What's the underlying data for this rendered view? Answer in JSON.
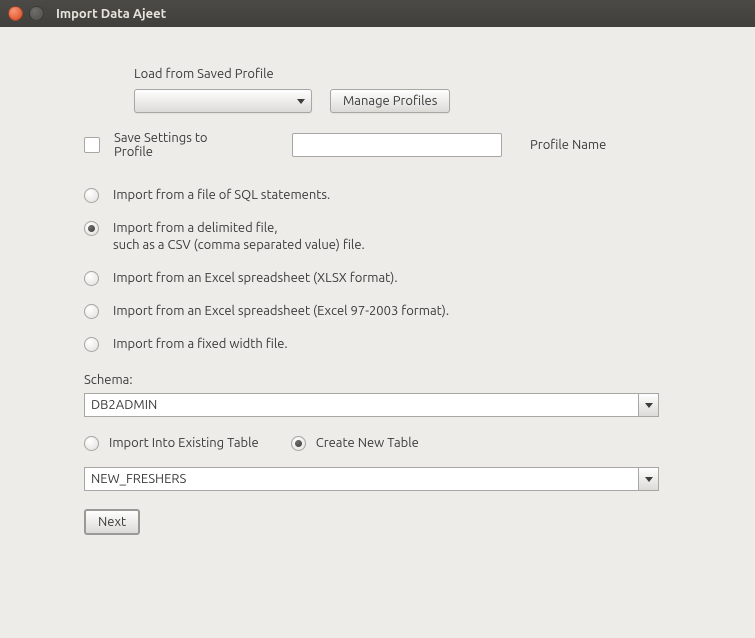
{
  "window": {
    "title": "Import Data Ajeet"
  },
  "profile": {
    "load_label": "Load from Saved Profile",
    "manage_button": "Manage Profiles",
    "save_label": "Save Settings to Profile",
    "profile_name_label": "Profile Name",
    "selected_profile": "",
    "profile_name_value": ""
  },
  "import_options": [
    {
      "label": "Import from a file of SQL statements.",
      "selected": false
    },
    {
      "label": "Import from a delimited file,\nsuch as a CSV (comma separated value) file.",
      "selected": true
    },
    {
      "label": "Import from an Excel spreadsheet (XLSX format).",
      "selected": false
    },
    {
      "label": "Import from an Excel spreadsheet (Excel 97-2003 format).",
      "selected": false
    },
    {
      "label": "Import from a fixed width file.",
      "selected": false
    }
  ],
  "schema": {
    "label": "Schema:",
    "value": "DB2ADMIN"
  },
  "destination": {
    "existing_label": "Import Into Existing Table",
    "create_label": "Create New Table",
    "existing_selected": false,
    "create_selected": true
  },
  "table": {
    "value": "NEW_FRESHERS"
  },
  "buttons": {
    "next": "Next"
  }
}
